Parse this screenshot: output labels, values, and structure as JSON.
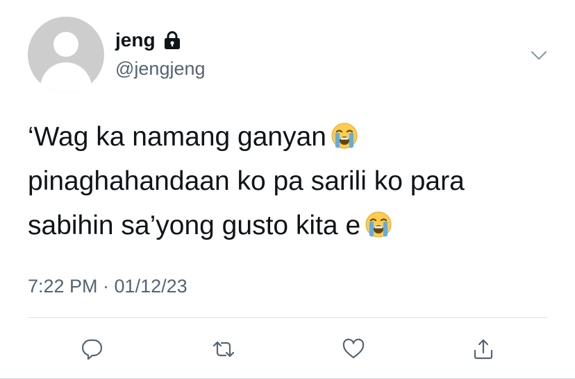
{
  "user": {
    "display_name": "jeng",
    "handle": "@jengjeng",
    "protected_icon": "lock-icon",
    "avatar_icon": "default-avatar-icon"
  },
  "menu": {
    "icon": "chevron-down-icon"
  },
  "tweet": {
    "lines": [
      "‘Wag ka namang ganyan",
      "pinaghahandaan ko pa sarili ko para",
      "sabihin sa’yong gusto kita e"
    ],
    "emoji": "loudly-crying-face",
    "timestamp": "7:22 PM · 01/12/23"
  },
  "actions": [
    {
      "name": "reply",
      "icon": "reply-icon"
    },
    {
      "name": "retweet",
      "icon": "retweet-icon"
    },
    {
      "name": "like",
      "icon": "heart-icon"
    },
    {
      "name": "share",
      "icon": "share-icon"
    }
  ],
  "colors": {
    "text": "#0f1419",
    "secondary": "#536471",
    "avatar": "#cdcdcd",
    "emoji_face": "#ffcc4d",
    "emoji_tear": "#5dadec"
  }
}
